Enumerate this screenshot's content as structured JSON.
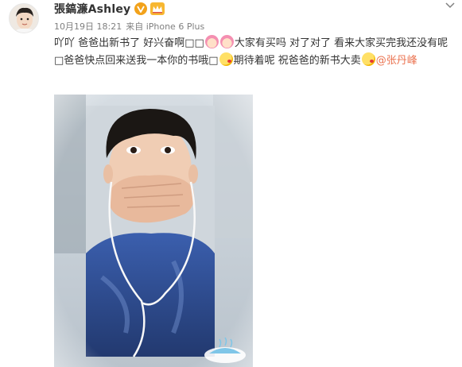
{
  "author": {
    "name": "張鎬濂Ashley",
    "date": "10月19日 18:21",
    "source": "来自 iPhone 6 Plus"
  },
  "post": {
    "segments": [
      "吖吖 爸爸出新书了 好兴奋啊□□",
      "大家有买吗 对了对了 看来大家买完我还没有呢 □爸爸快点回来送我一本你的书哦□",
      "期待着呢 祝爸爸的新书大卖"
    ],
    "mention": "@张丹峰"
  },
  "colors": {
    "mention": "#eb7350",
    "verified": "#f2a21b",
    "meta": "#808080"
  },
  "icons": [
    "avatar",
    "verified-badge-icon",
    "member-crown-icon",
    "chevron-down-icon",
    "emoji-girl-icon",
    "emoji-kiss-icon"
  ]
}
